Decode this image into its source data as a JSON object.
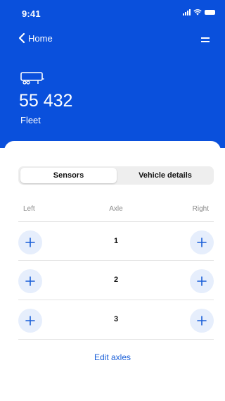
{
  "status_bar": {
    "time": "9:41",
    "icons": [
      "signal-icon",
      "wifi-icon",
      "battery-icon"
    ]
  },
  "nav": {
    "back_label": "Home",
    "back_icon": "chevron-left-icon",
    "menu_icon": "menu-icon"
  },
  "vehicle": {
    "icon": "trailer-icon",
    "number": "55 432",
    "subtitle": "Fleet"
  },
  "tabs": [
    {
      "label": "Sensors",
      "active": true
    },
    {
      "label": "Vehicle details",
      "active": false
    }
  ],
  "axle_table": {
    "headers": {
      "left": "Left",
      "axle": "Axle",
      "right": "Right"
    },
    "rows": [
      {
        "axle": "1"
      },
      {
        "axle": "2"
      },
      {
        "axle": "3"
      }
    ],
    "add_icon": "plus-icon"
  },
  "edit_axles_label": "Edit axles",
  "colors": {
    "header_blue": "#0a50dc",
    "accent_blue": "#1a5fd8",
    "button_bg": "#e6eefc"
  }
}
